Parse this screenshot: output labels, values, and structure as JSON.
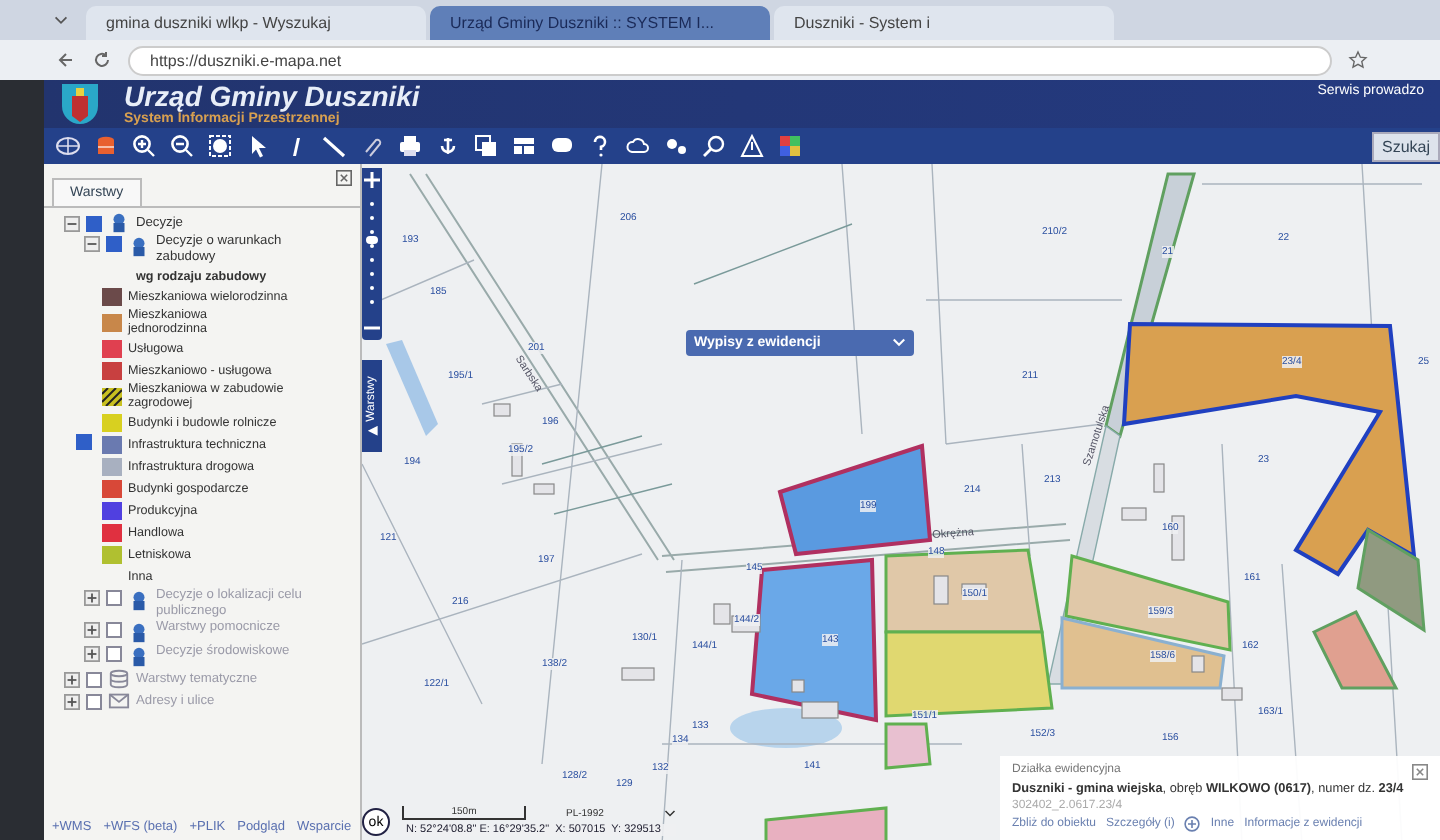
{
  "browser": {
    "tabs": [
      {
        "label": "gmina duszniki wlkp - Wyszukaj",
        "selected": false
      },
      {
        "label": "Urząd Gminy Duszniki :: SYSTEM I...",
        "selected": true
      },
      {
        "label": "Duszniki - System i",
        "selected": false
      }
    ],
    "url": "https://duszniki.e-mapa.net"
  },
  "header": {
    "title": "Urząd Gminy Duszniki",
    "subtitle": "System Informacji Przestrzennej",
    "service_text": "Serwis prowadzo",
    "search_button": "Szukaj"
  },
  "layers": {
    "tab": "Warstwy",
    "tree": [
      {
        "label": "Decyzje",
        "kind": "group",
        "checked": true,
        "expanded": true,
        "children": [
          {
            "label": "Decyzje o warunkach zabudowy",
            "kind": "group",
            "checked": true,
            "expanded": true,
            "legend": {
              "heading": "wg rodzaju zabudowy",
              "items": [
                {
                  "label": "Mieszkaniowa wielorodzinna",
                  "kind": "solid",
                  "color": "#6b4a4a",
                  "checked": false
                },
                {
                  "label": "Mieszkaniowa jednorodzinna",
                  "kind": "solid",
                  "color": "#c8874a",
                  "checked": false
                },
                {
                  "label": "Usługowa",
                  "kind": "solid",
                  "color": "#e04050",
                  "checked": false
                },
                {
                  "label": "Mieszkaniowo - usługowa",
                  "kind": "solid",
                  "color": "#c84040",
                  "checked": false
                },
                {
                  "label": "Mieszkaniowa w zabudowie zagrodowej",
                  "kind": "hatched",
                  "color": "#c8c020",
                  "checked": false
                },
                {
                  "label": "Budynki i budowle rolnicze",
                  "kind": "solid",
                  "color": "#d8d020",
                  "checked": false
                },
                {
                  "label": "Infrastruktura techniczna",
                  "kind": "solid",
                  "color": "#6a7ab0",
                  "checked": true
                },
                {
                  "label": "Infrastruktura drogowa",
                  "kind": "solid",
                  "color": "#a8b0c0",
                  "checked": false
                },
                {
                  "label": "Budynki gospodarcze",
                  "kind": "solid",
                  "color": "#d84838",
                  "checked": false
                },
                {
                  "label": "Produkcyjna",
                  "kind": "solid",
                  "color": "#5040e0",
                  "checked": false
                },
                {
                  "label": "Handlowa",
                  "kind": "solid",
                  "color": "#e03040",
                  "checked": false
                },
                {
                  "label": "Letniskowa",
                  "kind": "solid",
                  "color": "#b0c030",
                  "checked": false
                },
                {
                  "label": "Inna",
                  "kind": "none",
                  "checked": false
                }
              ]
            }
          },
          {
            "label": "Decyzje o lokalizacji celu publicznego",
            "kind": "group",
            "checked": false,
            "expanded": false
          },
          {
            "label": "Warstwy pomocnicze",
            "kind": "group",
            "checked": false,
            "expanded": false
          },
          {
            "label": "Decyzje środowiskowe",
            "kind": "group",
            "checked": false,
            "expanded": false
          }
        ]
      },
      {
        "label": "Warstwy tematyczne",
        "kind": "stack",
        "checked": false,
        "expanded": false
      },
      {
        "label": "Adresy i ulice",
        "kind": "mail",
        "checked": false,
        "expanded": false
      }
    ],
    "links": [
      "+WMS",
      "+WFS (beta)",
      "+PLIK",
      "Podgląd",
      "Wsparcie"
    ]
  },
  "map": {
    "zoom": {
      "level": 0.625
    },
    "side_tab": "Warstwy",
    "dropdown": "Wypisy z ewidencji",
    "parcels": [
      "206",
      "193",
      "185",
      "201",
      "195/1",
      "195/2",
      "196",
      "194",
      "121",
      "197",
      "216",
      "210/2",
      "21",
      "22",
      "211",
      "23/4",
      "25",
      "199",
      "214",
      "213",
      "23",
      "160",
      "145",
      "148",
      "161",
      "143",
      "150/1",
      "159/3",
      "158/6",
      "162",
      "144/2",
      "144/1",
      "130/1",
      "138/2",
      "122/1",
      "133",
      "134",
      "132",
      "129",
      "128/2",
      "141",
      "151/1",
      "152/3",
      "156",
      "163/1"
    ],
    "streets": [
      "Sarbska",
      "Szamotulska",
      "Okrężna"
    ],
    "scale": "150m",
    "crs": "PL-1992",
    "ok_button": "ok",
    "coordinates": "N: 52°24'08.8\" E: 16°29'35.2\"  X: 507015  Y: 329513",
    "popup": {
      "heading": "Działka ewidencyjna",
      "line": "**Duszniki - gmina wiejska**, obręb **WILKOWO (0617)**, numer dz. **23/4**",
      "id": "302402_2.0617.23/4",
      "links": [
        "Zbliż do obiektu",
        "Szczegóły (i)",
        "Inne",
        "Informacje z ewidencji"
      ]
    }
  }
}
